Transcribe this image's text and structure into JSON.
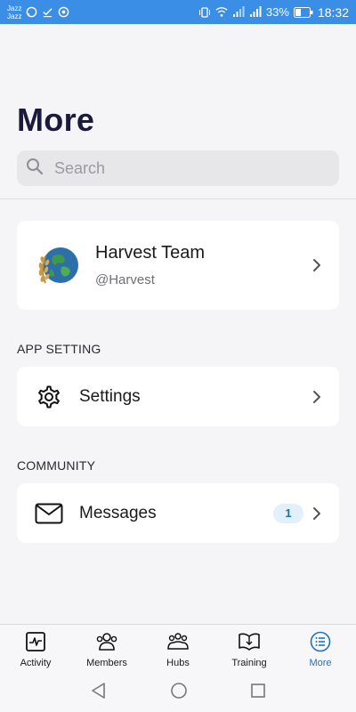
{
  "status_bar": {
    "carrier_top": "Jazz",
    "carrier_bottom": "Jazz",
    "battery": "33%",
    "time": "18:32"
  },
  "header": {
    "title": "More",
    "search_placeholder": "Search"
  },
  "profile": {
    "name": "Harvest Team",
    "handle": "@Harvest"
  },
  "sections": {
    "app_setting_label": "APP SETTING",
    "community_label": "COMMUNITY"
  },
  "settings_row": {
    "label": "Settings",
    "icon": "gear-icon"
  },
  "messages_row": {
    "label": "Messages",
    "icon": "envelope-icon",
    "badge": "1"
  },
  "bottom_nav": {
    "items": [
      {
        "label": "Activity",
        "icon": "activity-icon"
      },
      {
        "label": "Members",
        "icon": "members-icon"
      },
      {
        "label": "Hubs",
        "icon": "hubs-icon"
      },
      {
        "label": "Training",
        "icon": "training-icon"
      },
      {
        "label": "More",
        "icon": "more-list-icon",
        "active": true
      }
    ]
  },
  "colors": {
    "status_bar": "#3a8ee6",
    "title": "#1b1a3d",
    "active_nav": "#1e73be",
    "badge_bg": "#e2f0fb",
    "page_bg": "#f5f5f7"
  }
}
